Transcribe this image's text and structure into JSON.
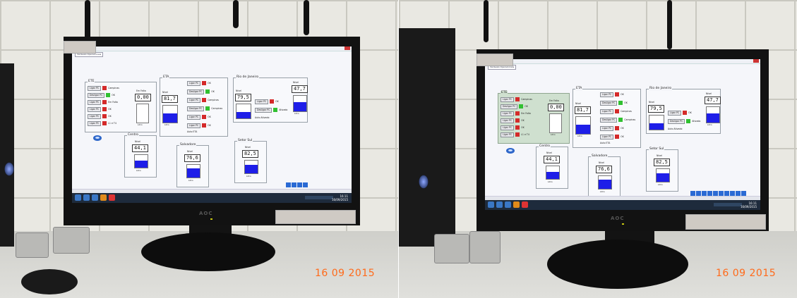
{
  "photos": [
    {
      "date_stamp": "16 09 2015",
      "monitor_brand": "AOC",
      "screen": {
        "tab_label": "Variáveis Operacionais",
        "panels": {
          "main": {
            "title": "ETE",
            "buttons": [
              {
                "label": "Ligar PC",
                "led": "red",
                "tag": "Campinas"
              },
              {
                "label": "Desligar PC",
                "led": "green",
                "tag": "OK"
              },
              {
                "label": "Ligar PC",
                "led": "red",
                "tag": "Em Falta"
              },
              {
                "label": "Ligar PC",
                "led": "red",
                "tag": "OK"
              },
              {
                "label": "Ligar PC",
                "led": "red",
                "tag": "OK"
              },
              {
                "label": "Ligar PC",
                "led": "red",
                "tag": "L1 e T4"
              }
            ],
            "level_caption": "Em Falta",
            "level_value": "0,00",
            "tank_label": "Litro"
          },
          "ete": {
            "title": "ETA",
            "value_caption": "Nível",
            "value": "81,7",
            "fill": 0.55,
            "tank_label": "Litro",
            "buttons": [
              {
                "label": "Ligar PC",
                "led": "red",
                "tag": "OK"
              },
              {
                "label": "Desligar PC",
                "led": "green",
                "tag": "OK"
              },
              {
                "label": "Ligar PC",
                "led": "red",
                "tag": "Campinas"
              },
              {
                "label": "Desligar PC",
                "led": "green",
                "tag": "Campinas"
              },
              {
                "label": "Ligar PC",
                "led": "red",
                "tag": "OK"
              },
              {
                "label": "Ligar PC",
                "led": "red",
                "tag": "OK"
              }
            ],
            "notes": [
              "Auto ETA",
              "Auto ETA",
              "Auto ETA"
            ]
          },
          "rio": {
            "title": "Rio de Janeiro",
            "value_caption": "Nível",
            "value": "79,5",
            "fill": 0.45,
            "right_caption": "Nível",
            "right_value": "47,7",
            "right_fill": 0.6,
            "tank_label": "Litro",
            "buttons": [
              {
                "label": "Ligar PC",
                "led": "red",
                "tag": "OK"
              },
              {
                "label": "Desligar PC",
                "led": "green",
                "tag": "Ativado"
              }
            ],
            "note": "Auto Ativado"
          },
          "centro": {
            "title": "Centro",
            "value_caption": "Nível",
            "value": "44,1",
            "fill": 0.55,
            "tank_label": "Litro"
          },
          "salvadore": {
            "title": "Salvadore",
            "value_caption": "Nível",
            "value": "76,6",
            "fill": 0.7,
            "tank_label": "Litro"
          },
          "setor": {
            "title": "Setor Sul",
            "value_caption": "Nível",
            "value": "82,5",
            "fill": 0.65,
            "tank_label": "Litro"
          }
        },
        "progress_blocks": 4,
        "clock": [
          "16:11",
          "16/09/2015"
        ]
      }
    },
    {
      "date_stamp": "16 09 2015",
      "monitor_brand": "AOC",
      "screen": {
        "tab_label": "Variáveis Operacionais",
        "panels": {
          "main": {
            "title": "ETE",
            "buttons": [
              {
                "label": "Ligar PC",
                "led": "red",
                "tag": "Campinas"
              },
              {
                "label": "Desligar PC",
                "led": "green",
                "tag": "OK"
              },
              {
                "label": "Ligar PC",
                "led": "red",
                "tag": "Em Falta"
              },
              {
                "label": "Ligar PC",
                "led": "red",
                "tag": "OK"
              },
              {
                "label": "Ligar PC",
                "led": "red",
                "tag": "OK"
              },
              {
                "label": "Ligar PC",
                "led": "red",
                "tag": "L1 e T4"
              }
            ],
            "level_caption": "Em Falta",
            "level_value": "0,00",
            "tank_label": "Litro"
          },
          "ete": {
            "title": "ETA",
            "value_caption": "Nível",
            "value": "81,7",
            "fill": 0.55,
            "tank_label": "Litro",
            "buttons": [
              {
                "label": "Ligar PC",
                "led": "red",
                "tag": "OK"
              },
              {
                "label": "Desligar PC",
                "led": "green",
                "tag": "OK"
              },
              {
                "label": "Ligar PC",
                "led": "red",
                "tag": "Campinas"
              },
              {
                "label": "Desligar PC",
                "led": "green",
                "tag": "Campinas"
              },
              {
                "label": "Ligar PC",
                "led": "red",
                "tag": "OK"
              },
              {
                "label": "Ligar PC",
                "led": "red",
                "tag": "OK"
              }
            ],
            "notes": [
              "Auto ETA",
              "Auto ETA",
              "Auto ETA"
            ]
          },
          "rio": {
            "title": "Rio de Janeiro",
            "value_caption": "Nível",
            "value": "79,5",
            "fill": 0.45,
            "right_caption": "Nível",
            "right_value": "47,7",
            "right_fill": 0.6,
            "tank_label": "Litro",
            "buttons": [
              {
                "label": "Ligar PC",
                "led": "red",
                "tag": "OK"
              },
              {
                "label": "Desligar PC",
                "led": "green",
                "tag": "Ativado"
              }
            ],
            "note": "Auto Ativado"
          },
          "centro": {
            "title": "Centro",
            "value_caption": "Nível",
            "value": "44,1",
            "fill": 0.55,
            "tank_label": "Litro"
          },
          "salvadore": {
            "title": "Salvadore",
            "value_caption": "Nível",
            "value": "76,6",
            "fill": 0.7,
            "tank_label": "Litro"
          },
          "setor": {
            "title": "Setor Sul",
            "value_caption": "Nível",
            "value": "82,5",
            "fill": 0.65,
            "tank_label": "Litro"
          }
        },
        "progress_blocks": 10,
        "clock": [
          "16:11",
          "16/09/2015"
        ]
      }
    }
  ],
  "colors": {
    "tank_fill": "#1e1ee8",
    "led_red": "#d42a2a",
    "led_green": "#31c031",
    "stamp": "#ff6a1a",
    "selected_panel": "#cfe0cf"
  }
}
